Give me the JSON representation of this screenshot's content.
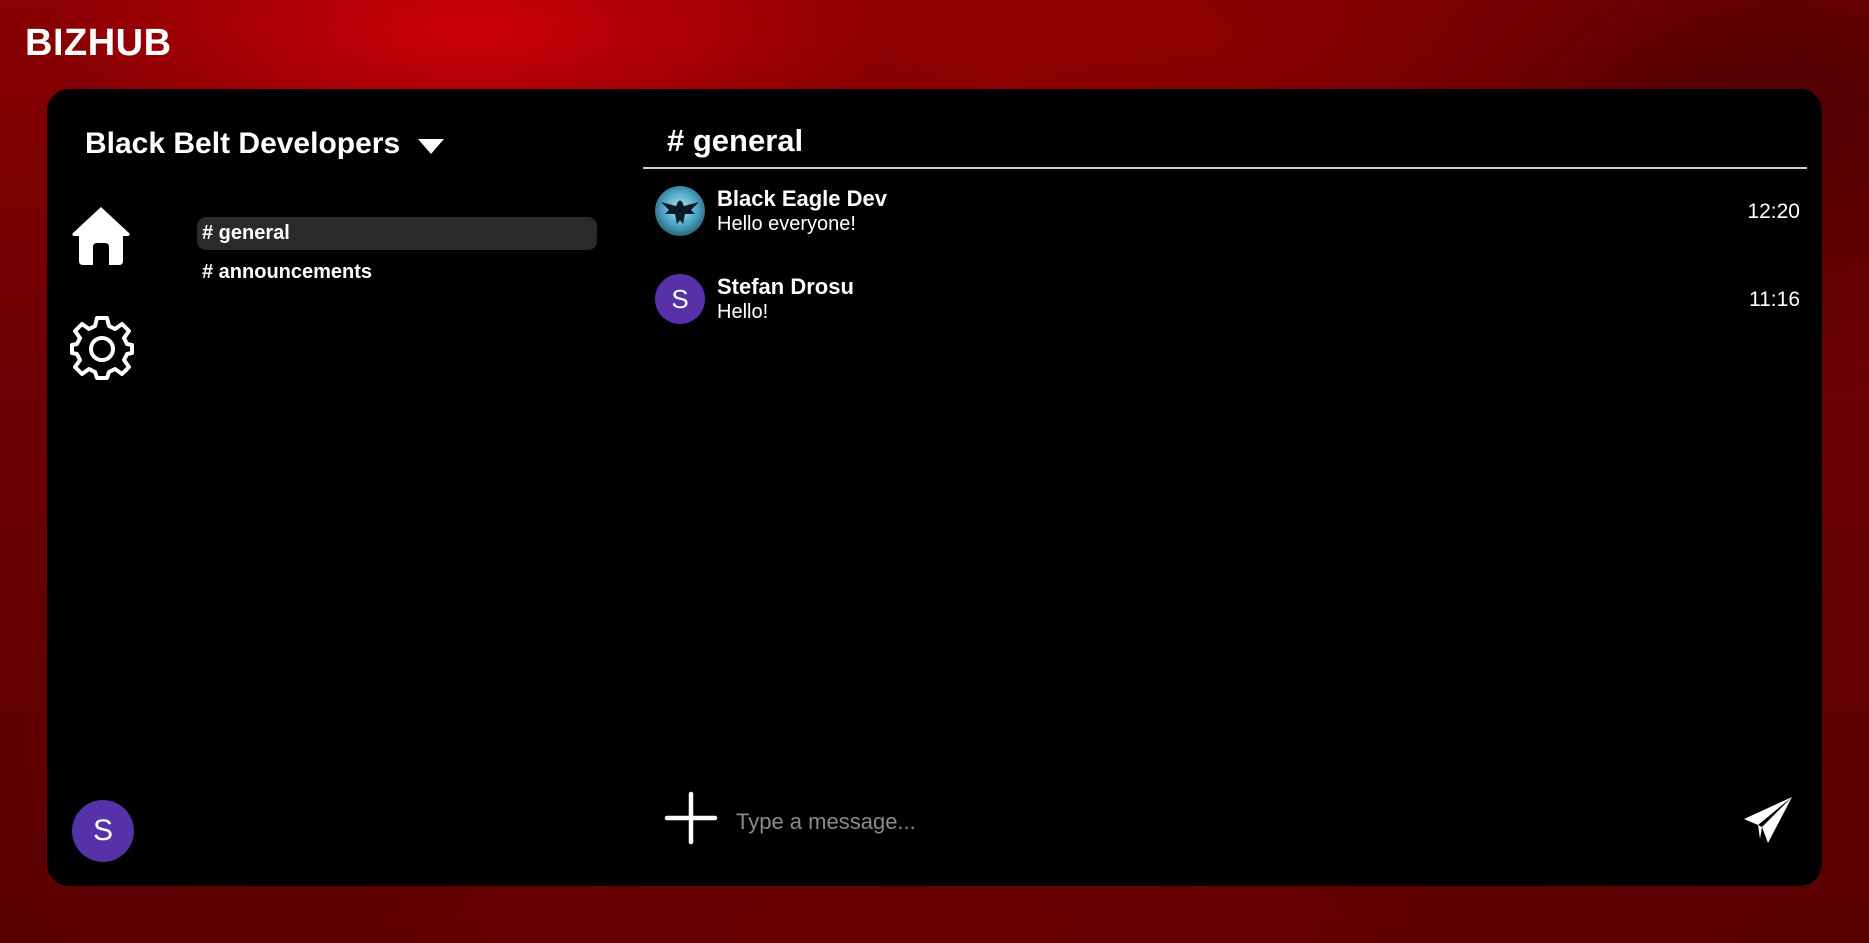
{
  "app": {
    "brand": "BIZHUB"
  },
  "server": {
    "name": "Black Belt Developers"
  },
  "nav": {
    "home_icon": "home-icon",
    "settings_icon": "gear-icon"
  },
  "user": {
    "initial": "S",
    "avatar_color": "#5631a8"
  },
  "channels": [
    {
      "label": "# general",
      "active": true
    },
    {
      "label": "# announcements",
      "active": false
    }
  ],
  "chat": {
    "title": "# general",
    "messages": [
      {
        "author": "Black Eagle Dev",
        "text": "Hello everyone!",
        "time": "12:20",
        "avatar": "eagle-image"
      },
      {
        "author": "Stefan Drosu",
        "text": "Hello!",
        "time": "11:16",
        "avatar_initial": "S"
      }
    ]
  },
  "composer": {
    "placeholder": "Type a message...",
    "add_icon": "plus-icon",
    "send_icon": "send-icon"
  },
  "colors": {
    "accent": "#5631a8",
    "background": "#8a0003",
    "panel": "#000000",
    "active_channel": "#2a2a2a"
  }
}
